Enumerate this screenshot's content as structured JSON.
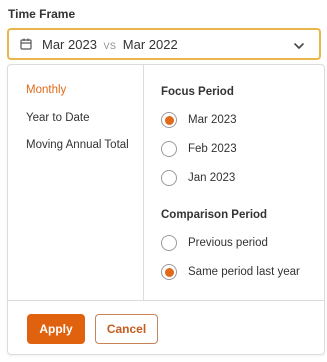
{
  "header": {
    "label": "Time Frame"
  },
  "selector": {
    "focus_value": "Mar 2023",
    "vs_label": "VS",
    "comparison_value": "Mar 2022"
  },
  "icons": {
    "calendar": "calendar-icon",
    "chevron": "chevron-down-icon"
  },
  "period_types": [
    {
      "label": "Monthly",
      "active": true
    },
    {
      "label": "Year to Date",
      "active": false
    },
    {
      "label": "Moving Annual Total",
      "active": false
    }
  ],
  "focus_period": {
    "title": "Focus Period",
    "options": [
      {
        "label": "Mar 2023",
        "selected": true
      },
      {
        "label": "Feb 2023",
        "selected": false
      },
      {
        "label": "Jan 2023",
        "selected": false
      }
    ]
  },
  "comparison_period": {
    "title": "Comparison Period",
    "options": [
      {
        "label": "Previous period",
        "selected": false
      },
      {
        "label": "Same period last year",
        "selected": true
      }
    ]
  },
  "actions": {
    "apply_label": "Apply",
    "cancel_label": "Cancel"
  },
  "colors": {
    "accent": "#e0620f",
    "active_text": "#e06a1a",
    "selector_border": "#e8b64a"
  }
}
